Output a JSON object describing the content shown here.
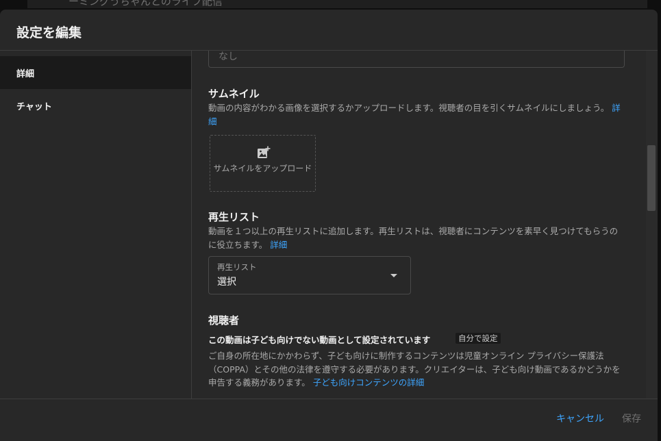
{
  "background": {
    "title": "ーミングうちゃんとのライブ配信"
  },
  "dialog": {
    "title": "設定を編集",
    "sidebar": [
      {
        "label": "詳細",
        "active": true
      },
      {
        "label": "チャット",
        "active": false
      }
    ],
    "prev_field": {
      "placeholder": "なし"
    },
    "thumbnail": {
      "heading": "サムネイル",
      "description": "動画の内容がわかる画像を選択するかアップロードします。視聴者の目を引くサムネイルにしましょう。",
      "link": "詳細",
      "upload_label": "サムネイルをアップロード",
      "upload_icon": "add-photo-icon"
    },
    "playlist": {
      "heading": "再生リスト",
      "description": "動画を１つ以上の再生リストに追加します。再生リストは、視聴者にコンテンツを素早く見つけてもらうのに役立ちます。",
      "link": "詳細",
      "select_label": "再生リスト",
      "select_value": "選択",
      "select_icon": "caret-down-icon"
    },
    "audience": {
      "heading": "視聴者",
      "status": "この動画は子ども向けでない動画として設定されています",
      "chip": "自分で設定",
      "description": "ご自身の所在地にかかわらず、子ども向けに制作するコンテンツは児童オンライン プライバシー保護法（COPPA）とその他の法律を遵守する必要があります。クリエイターは、子ども向け動画であるかどうかを申告する義務があります。",
      "link": "子ども向けコンテンツの詳細"
    },
    "footer": {
      "cancel": "キャンセル",
      "save": "保存"
    }
  },
  "colors": {
    "link": "#3ea6ff",
    "dialog_bg": "#282828",
    "active_bg": "#1a1a1a"
  }
}
